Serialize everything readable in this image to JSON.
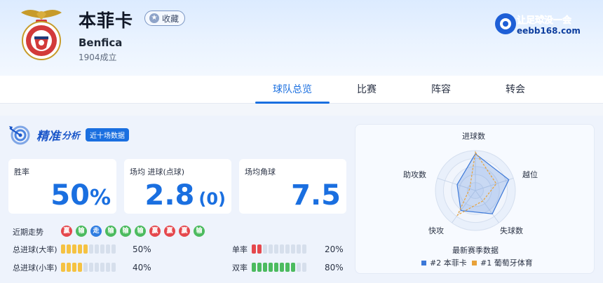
{
  "header": {
    "team_name": "本菲卡",
    "favorite_label": "收藏",
    "team_name_en": "Benfica",
    "founded": "1904成立",
    "site_logo_text": "让足球没一会",
    "site_logo_domain": "eebb168.com"
  },
  "tabs": [
    {
      "label": "球队总览",
      "active": true
    },
    {
      "label": "比赛",
      "active": false
    },
    {
      "label": "阵容",
      "active": false
    },
    {
      "label": "转会",
      "active": false
    }
  ],
  "analysis": {
    "title_main": "精准",
    "title_sub": "分析",
    "badge": "近十场数据",
    "stats": [
      {
        "label": "胜率",
        "value": "50",
        "unit": "%"
      },
      {
        "label": "场均 进球(点球)",
        "value": "2.8",
        "extra": "(0)"
      },
      {
        "label": "场均角球",
        "value": "7.5"
      }
    ],
    "trend_label": "近期走势",
    "trend": [
      {
        "result": "win",
        "text": "赢"
      },
      {
        "result": "lose",
        "text": "输"
      },
      {
        "result": "draw",
        "text": "走"
      },
      {
        "result": "lose",
        "text": "输"
      },
      {
        "result": "lose",
        "text": "输"
      },
      {
        "result": "lose",
        "text": "输"
      },
      {
        "result": "win",
        "text": "赢"
      },
      {
        "result": "win",
        "text": "赢"
      },
      {
        "result": "win",
        "text": "赢"
      },
      {
        "result": "lose",
        "text": "输"
      }
    ],
    "bars": [
      {
        "label": "总进球(大率)",
        "value": "50%",
        "filled": 5,
        "total": 10,
        "color": "#f5c242"
      },
      {
        "label": "总进球(小率)",
        "value": "40%",
        "filled": 4,
        "total": 10,
        "color": "#f5c242"
      },
      {
        "label": "单率",
        "value": "20%",
        "filled": 2,
        "total": 10,
        "color": "#e5484d"
      },
      {
        "label": "双率",
        "value": "80%",
        "filled": 8,
        "total": 10,
        "color": "#4cbb5f"
      }
    ]
  },
  "radar": {
    "axes": [
      "进球数",
      "越位",
      "失球数",
      "快攻",
      "助攻数"
    ],
    "caption": "最新赛季数据",
    "series": [
      {
        "name": "#2 本菲卡",
        "color": "#3c78d8",
        "values": [
          0.92,
          0.88,
          0.72,
          0.62,
          0.48
        ]
      },
      {
        "name": "#1 葡萄牙体育",
        "color": "#e8a23a",
        "values": [
          0.96,
          0.55,
          0.32,
          0.76,
          0.15
        ]
      }
    ]
  }
}
